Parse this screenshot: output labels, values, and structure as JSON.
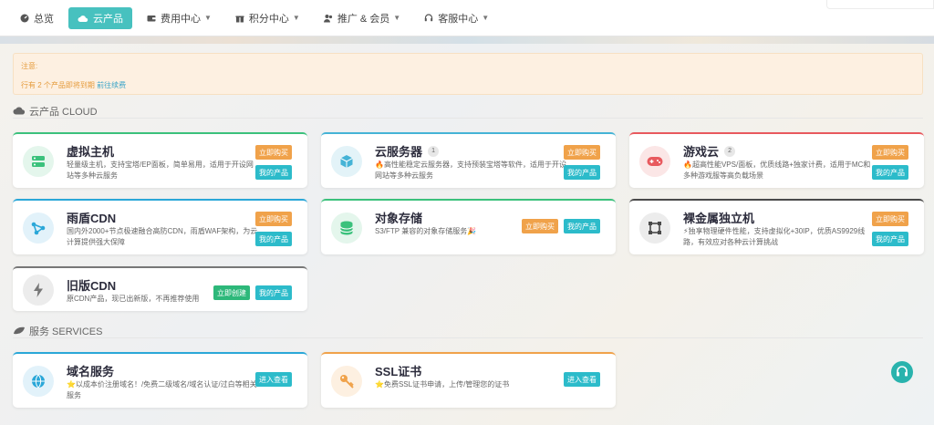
{
  "nav": {
    "items": [
      {
        "label": "总览",
        "icon": "dashboard-icon",
        "active": false,
        "caret": false
      },
      {
        "label": "云产品",
        "icon": "cloud-icon",
        "active": true,
        "caret": false
      },
      {
        "label": "费用中心",
        "icon": "wallet-icon",
        "active": false,
        "caret": true
      },
      {
        "label": "积分中心",
        "icon": "gift-icon",
        "active": false,
        "caret": true
      },
      {
        "label": "推广 & 会员",
        "icon": "users-icon",
        "active": false,
        "caret": true
      },
      {
        "label": "客服中心",
        "icon": "headset-icon",
        "active": false,
        "caret": true
      }
    ]
  },
  "notice": {
    "title": "注意:",
    "text": "行有 2 个产品即将到期",
    "link": "前往续费"
  },
  "sections": {
    "cloud": "云产品 CLOUD",
    "services": "服务 SERVICES"
  },
  "buttons": {
    "buy": "立即购买",
    "my": "我的产品",
    "create": "立即创建",
    "view": "进入查看"
  },
  "products": [
    {
      "name": "虚拟主机",
      "badge": "",
      "desc": "轻量级主机，支持宝塔/EP面板，简单易用，适用于开设网站等多种云服务",
      "icon": "server-icon",
      "color": "#3bc17c"
    },
    {
      "name": "云服务器",
      "badge": "1",
      "desc": "🔥高性能稳定云服务器，支持预装宝塔等软件，适用于开设网站等多种云服务",
      "icon": "cube-icon",
      "color": "#45b3d6"
    },
    {
      "name": "游戏云",
      "badge": "2",
      "desc": "🔥超高性能VPS/面板，优质线路+独家计费，适用于MC和多种游戏服等高负载场景",
      "icon": "gamepad-icon",
      "color": "#e8595e"
    },
    {
      "name": "雨盾CDN",
      "badge": "",
      "desc": "国内外2000+节点极速融合高防CDN，雨盾WAF架构，为云计算提供强大保障",
      "icon": "share-icon",
      "color": "#2aa7d8"
    },
    {
      "name": "对象存储",
      "badge": "",
      "desc": "S3/FTP 兼容的对象存储服务🎉",
      "icon": "database-icon",
      "color": "#3bc17c"
    },
    {
      "name": "裸金属独立机",
      "badge": "",
      "desc": "⚡独享物理硬件性能，支持虚拟化+30IP，优质AS9929线路，有效应对各种云计算挑战",
      "icon": "frame-icon",
      "color": "#4a4a4a"
    },
    {
      "name": "旧版CDN",
      "badge": "",
      "desc": "原CDN产品，现已出新版，不再推荐使用",
      "icon": "bolt-icon",
      "color": "#777777"
    }
  ],
  "services": [
    {
      "name": "域名服务",
      "desc": "⭐以成本价注册域名！/免费二级域名/域名认证/过白等相关服务",
      "icon": "globe-icon",
      "color": "#2aa7d8"
    },
    {
      "name": "SSL证书",
      "desc": "⭐免费SSL证书申请，上传/管理您的证书",
      "icon": "key-icon",
      "color": "#f0a24a"
    }
  ]
}
